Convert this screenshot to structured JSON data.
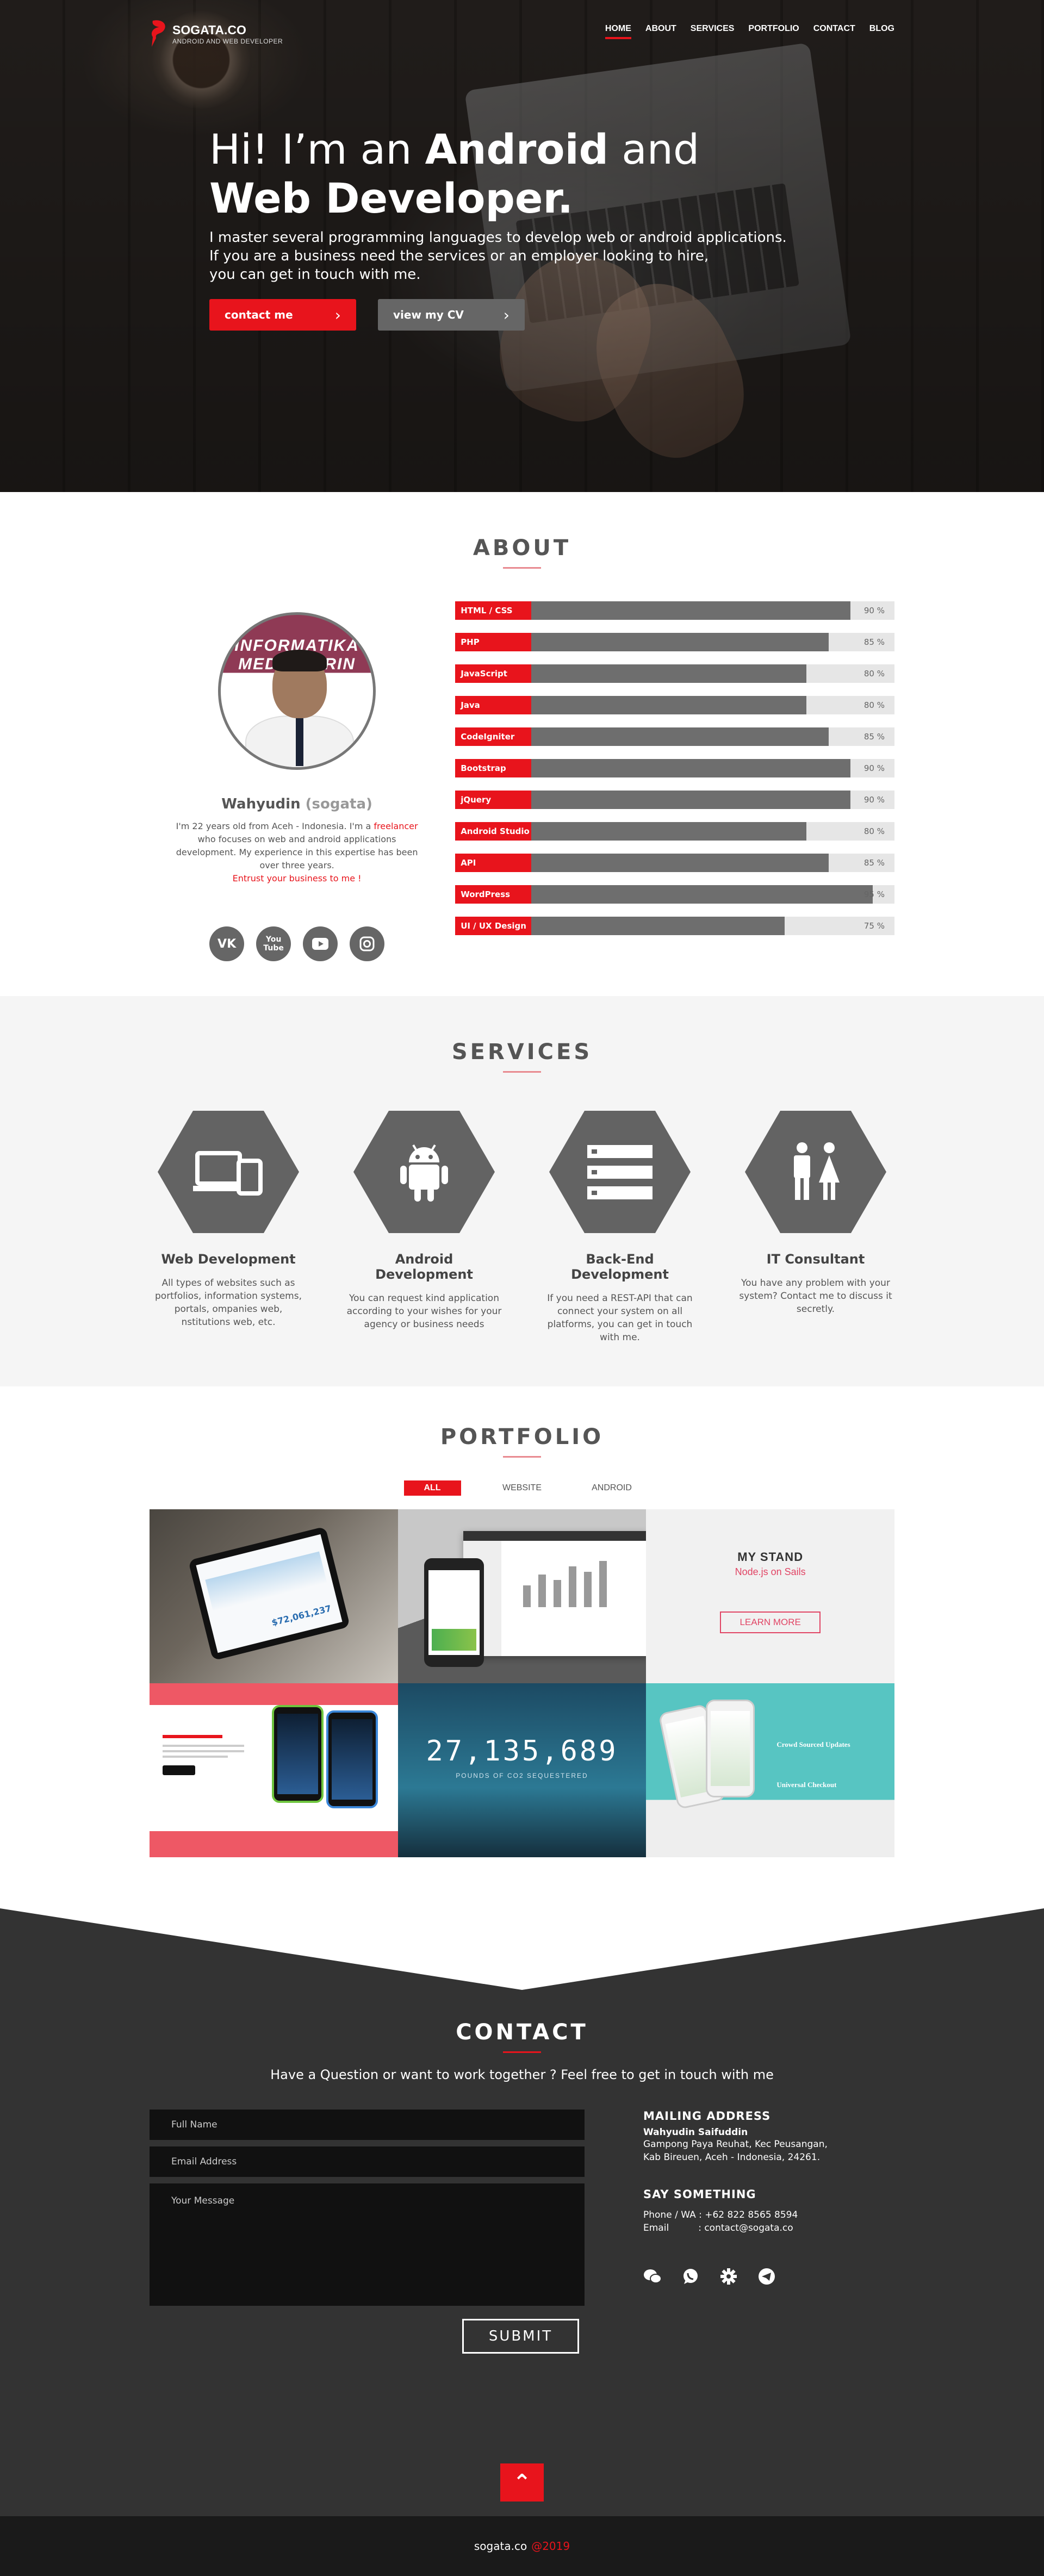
{
  "brand": {
    "name": "SOGATA.CO",
    "tagline": "ANDROID AND WEB DEVELOPER"
  },
  "nav": [
    {
      "label": "HOME",
      "active": true
    },
    {
      "label": "ABOUT"
    },
    {
      "label": "SERVICES"
    },
    {
      "label": "PORTFOLIO"
    },
    {
      "label": "CONTACT"
    },
    {
      "label": "BLOG"
    }
  ],
  "hero": {
    "line1_pre": "Hi! I’m an ",
    "line1_bold": "Android",
    "line1_post": " and",
    "line2_bold": "Web Developer.",
    "text1": "I master several programming languages to develop web or android applications.",
    "text2": "If you are a business need the services or an employer looking to hire,",
    "text3": "you can get in touch with me.",
    "btn_contact": "contact me",
    "btn_cv": "view my CV"
  },
  "about": {
    "title": "ABOUT",
    "name": "Wahyudin",
    "nick": "(sogata)",
    "bio1": "I'm 22 years old from Aceh - Indonesia. I'm a ",
    "bio_link": "freelancer",
    "bio2": " who focuses on web and android applications development. My experience in this expertise has been over three years.",
    "cta": "Entrust your business to me !",
    "photo_banner": "INFORMATIKA MEDIA JARIN",
    "social_icons": [
      "vk-icon",
      "youtube-old-icon",
      "youtube-icon",
      "instagram-icon"
    ]
  },
  "skills": [
    {
      "label": "HTML / CSS",
      "value": 90,
      "text": "90 %"
    },
    {
      "label": "PHP",
      "value": 85,
      "text": "85 %"
    },
    {
      "label": "JavaScript",
      "value": 80,
      "text": "80 %"
    },
    {
      "label": "Java",
      "value": 80,
      "text": "80 %"
    },
    {
      "label": "CodeIgniter",
      "value": 85,
      "text": "85 %"
    },
    {
      "label": "Bootstrap",
      "value": 90,
      "text": "90 %"
    },
    {
      "label": "jQuery",
      "value": 90,
      "text": "90 %"
    },
    {
      "label": "Android Studio",
      "value": 80,
      "text": "80 %"
    },
    {
      "label": "API",
      "value": 85,
      "text": "85 %"
    },
    {
      "label": "WordPress",
      "value": 95,
      "text": "95 %"
    },
    {
      "label": "UI / UX Design",
      "value": 75,
      "text": "75 %"
    }
  ],
  "services": {
    "title": "SERVICES",
    "items": [
      {
        "title": "Web Development",
        "text": "All types of websites such as portfolios, information systems, portals, ompanies web, nstitutions web, etc.",
        "icon": "devices-icon"
      },
      {
        "title": "Android Development",
        "text": "You can request kind application according to your wishes for your agency or business needs",
        "icon": "android-icon"
      },
      {
        "title": "Back-End Development",
        "text": "If you need a REST-API that can connect your system on all platforms, you can get in touch with me.",
        "icon": "server-icon"
      },
      {
        "title": "IT Consultant",
        "text": "You have any problem with your system? Contact me to discuss it secretly.",
        "icon": "people-icon"
      }
    ]
  },
  "portfolio": {
    "title": "PORTFOLIO",
    "filters": [
      "ALL",
      "WEBSITE",
      "ANDROID"
    ],
    "tile1_number": "$72,061,237",
    "tile3_title": "MY STAND",
    "tile3_sub": "Node.js on Sails",
    "tile3_btn": "LEARN MORE",
    "tile5_counter": "27,135,689",
    "tile5_sub": "POUNDS OF CO2 SEQUESTERED",
    "tile6_text1": "Crowd Sourced Updates",
    "tile6_text2": "Universal Checkout"
  },
  "contact": {
    "title": "CONTACT",
    "lead": "Have a Question or want to work together ? Feel free to get in touch with me",
    "ph_name": "Full Name",
    "ph_email": "Email Address",
    "ph_message": "Your Message",
    "submit": "SUBMIT",
    "mailing_title": "MAILING ADDRESS",
    "mailing_name": "Wahyudin Saifuddin",
    "mailing_line1": "Gampong Paya Reuhat, Kec Peusangan,",
    "mailing_line2": "Kab Bireuen, Aceh - Indonesia, 24261.",
    "say_title": "SAY SOMETHING",
    "phone": "Phone / WA : +62 822 8565 8594",
    "email": "Email          : contact@sogata.co",
    "icons": [
      "wechat-icon",
      "whatsapp-icon",
      "gear-icon",
      "telegram-icon"
    ]
  },
  "footer": {
    "site": "sogata.co",
    "year": "@2019"
  }
}
